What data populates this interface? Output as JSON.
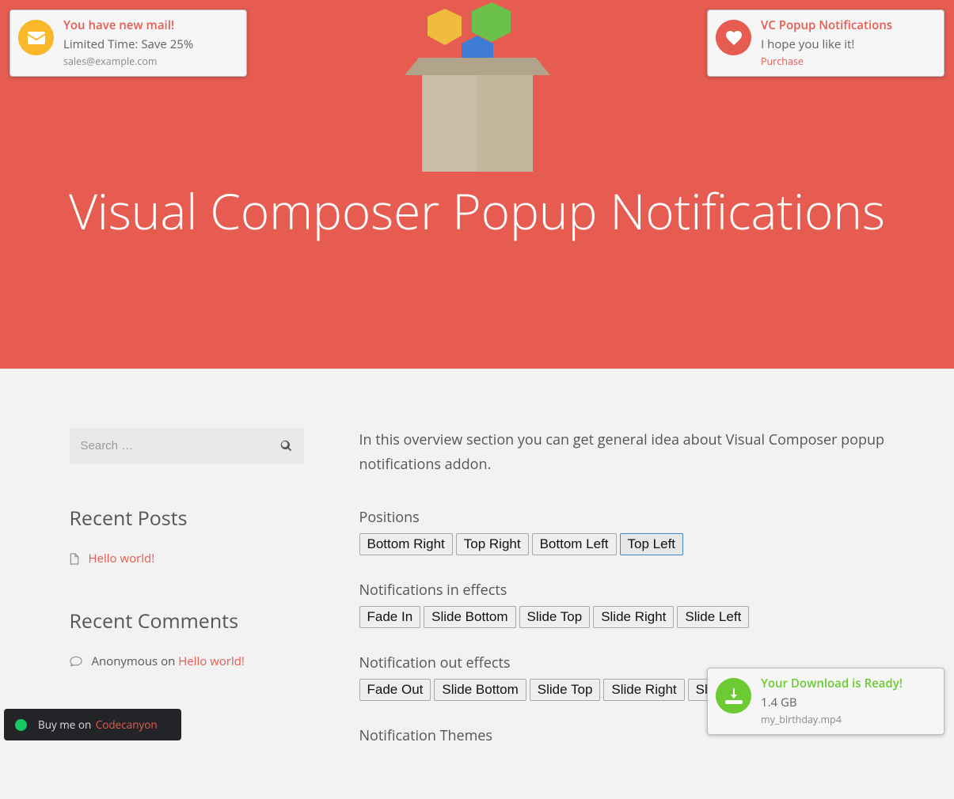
{
  "hero": {
    "title": "Visual Composer Popup Notifications"
  },
  "sidebar": {
    "search_placeholder": "Search …",
    "recent_posts_title": "Recent Posts",
    "recent_post_link": "Hello world!",
    "recent_comments_title": "Recent Comments",
    "comment_author": "Anonymous",
    "comment_on": " on ",
    "comment_link": "Hello world!"
  },
  "main": {
    "intro": "In this overview section you can get general idea about Visual Composer popup notifications addon.",
    "positions_label": "Positions",
    "positions": [
      "Bottom Right",
      "Top Right",
      "Bottom Left",
      "Top Left"
    ],
    "positions_active": "Top Left",
    "in_effects_label": "Notifications in effects",
    "in_effects": [
      "Fade In",
      "Slide Bottom",
      "Slide Top",
      "Slide Right",
      "Slide Left"
    ],
    "out_effects_label": "Notification out effects",
    "out_effects": [
      "Fade Out",
      "Slide Bottom",
      "Slide Top",
      "Slide Right",
      "Slide Left"
    ],
    "themes_label": "Notification Themes"
  },
  "toasts": {
    "tl": {
      "title": "You have new mail!",
      "sub": "Limited Time: Save 25%",
      "meta": "sales@example.com",
      "icon": "envelope-icon"
    },
    "tr": {
      "title": "VC Popup Notifications",
      "sub": "I hope you like it!",
      "meta": "Purchase",
      "icon": "heart-icon"
    },
    "br": {
      "title": "Your Download is Ready!",
      "sub": "1.4 GB",
      "meta": "my_birthday.mp4",
      "icon": "download-icon"
    }
  },
  "buybar": {
    "pre": "Buy me on ",
    "link": "Codecanyon"
  }
}
